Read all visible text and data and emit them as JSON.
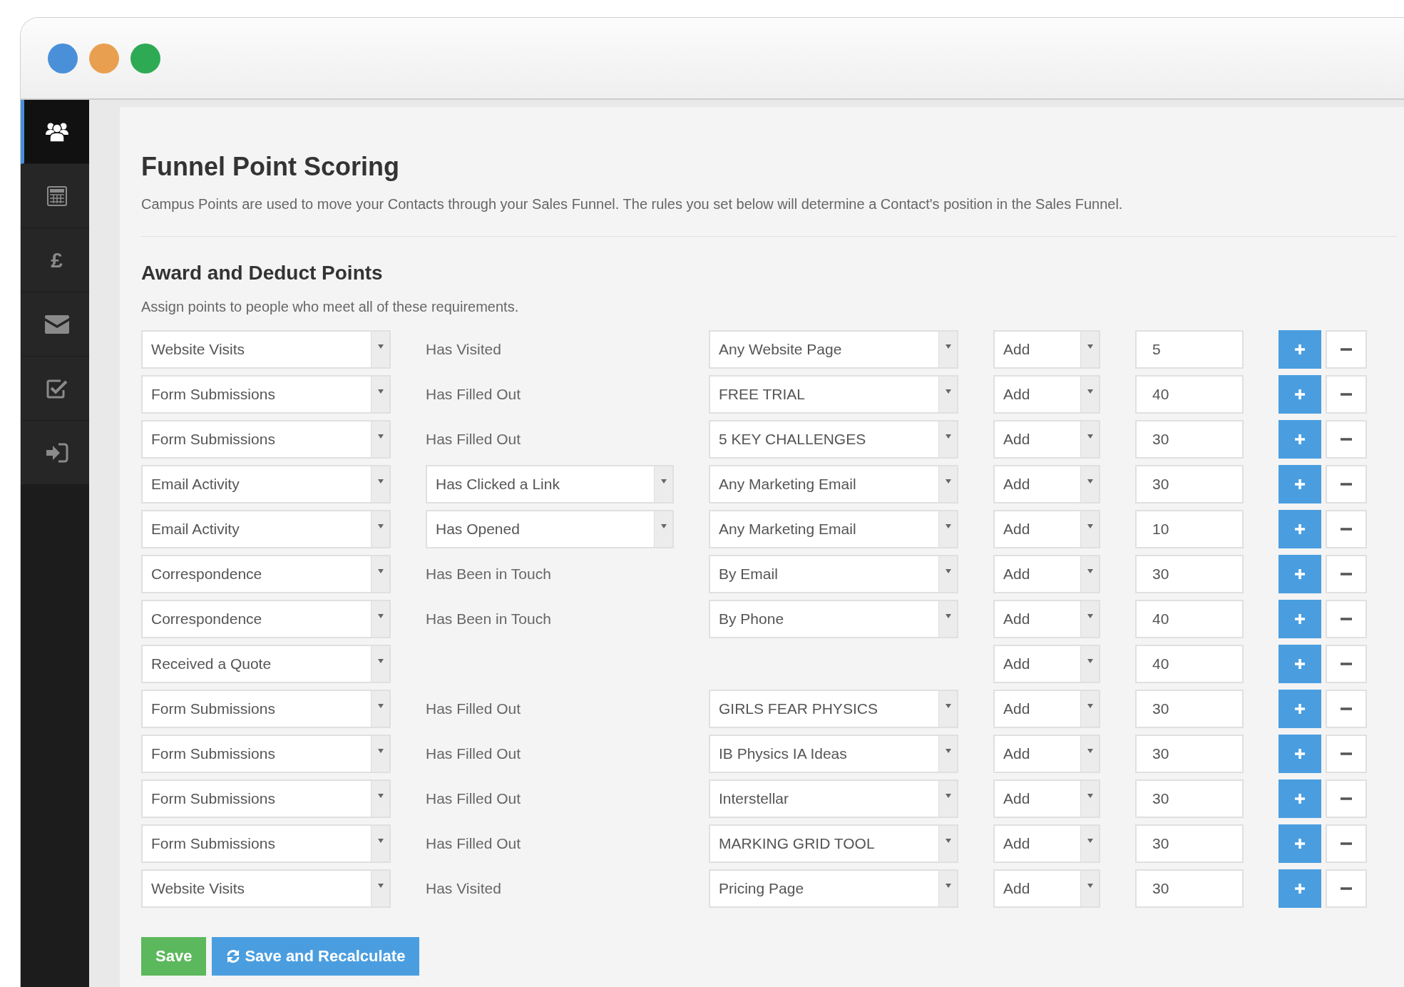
{
  "window": {
    "controls": [
      {
        "color": "#4a90d9"
      },
      {
        "color": "#e8a050"
      },
      {
        "color": "#2eaa55"
      }
    ]
  },
  "sidebar": {
    "items": [
      {
        "kind": "users",
        "selected": true
      },
      {
        "kind": "calculator",
        "selected": false
      },
      {
        "kind": "glyph",
        "glyph": "£",
        "selected": false
      },
      {
        "kind": "envelope",
        "selected": false
      },
      {
        "kind": "checkbox",
        "selected": false
      },
      {
        "kind": "signin",
        "selected": false
      }
    ]
  },
  "title": "Funnel Point Scoring",
  "description": "Campus Points are used to move your Contacts through your Sales Funnel. The rules you set below will determine a Contact's position in the Sales Funnel.",
  "section": {
    "title": "Award and Deduct Points",
    "subtitle": "Assign points to people who meet all of these requirements."
  },
  "rules": [
    {
      "source": "Website Visits",
      "condition": {
        "kind": "text",
        "label": "Has Visited"
      },
      "target": "Any Website Page",
      "action": "Add",
      "points": "5"
    },
    {
      "source": "Form Submissions",
      "condition": {
        "kind": "text",
        "label": "Has Filled Out"
      },
      "target": "FREE TRIAL",
      "action": "Add",
      "points": "40"
    },
    {
      "source": "Form Submissions",
      "condition": {
        "kind": "text",
        "label": "Has Filled Out"
      },
      "target": "5 KEY CHALLENGES",
      "action": "Add",
      "points": "30"
    },
    {
      "source": "Email Activity",
      "condition": {
        "kind": "select",
        "label": "Has Clicked a Link"
      },
      "target": "Any Marketing Email",
      "action": "Add",
      "points": "30"
    },
    {
      "source": "Email Activity",
      "condition": {
        "kind": "select",
        "label": "Has Opened"
      },
      "target": "Any Marketing Email",
      "action": "Add",
      "points": "10"
    },
    {
      "source": "Correspondence",
      "condition": {
        "kind": "text",
        "label": "Has Been in Touch"
      },
      "target": "By Email",
      "action": "Add",
      "points": "30"
    },
    {
      "source": "Correspondence",
      "condition": {
        "kind": "text",
        "label": "Has Been in Touch"
      },
      "target": "By Phone",
      "action": "Add",
      "points": "40"
    },
    {
      "source": "Received a Quote",
      "action": "Add",
      "points": "40"
    },
    {
      "source": "Form Submissions",
      "condition": {
        "kind": "text",
        "label": "Has Filled Out"
      },
      "target": "GIRLS FEAR PHYSICS",
      "action": "Add",
      "points": "30"
    },
    {
      "source": "Form Submissions",
      "condition": {
        "kind": "text",
        "label": "Has Filled Out"
      },
      "target": "IB Physics IA Ideas",
      "action": "Add",
      "points": "30"
    },
    {
      "source": "Form Submissions",
      "condition": {
        "kind": "text",
        "label": "Has Filled Out"
      },
      "target": "Interstellar",
      "action": "Add",
      "points": "30"
    },
    {
      "source": "Form Submissions",
      "condition": {
        "kind": "text",
        "label": "Has Filled Out"
      },
      "target": "MARKING GRID TOOL",
      "action": "Add",
      "points": "30"
    },
    {
      "source": "Website Visits",
      "condition": {
        "kind": "text",
        "label": "Has Visited"
      },
      "target": "Pricing Page",
      "action": "Add",
      "points": "30"
    }
  ],
  "buttons": [
    {
      "kind": "save",
      "label": "Save"
    },
    {
      "kind": "recalculate",
      "label": "Save and Recalculate"
    }
  ]
}
